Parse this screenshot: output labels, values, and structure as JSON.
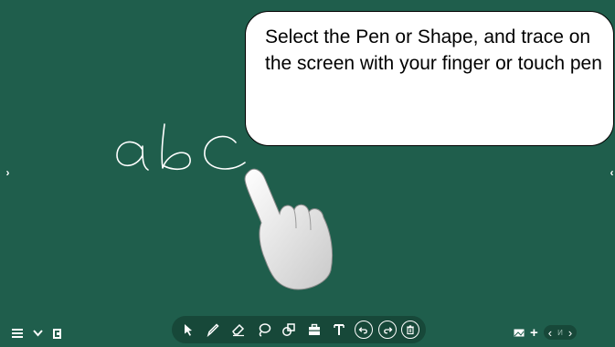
{
  "instruction": {
    "text": "Select the Pen or Shape, and trace on the screen with your finger or touch pen"
  },
  "handwriting": {
    "text": "abc"
  },
  "navigation": {
    "left_panel_arrow": "›",
    "right_panel_arrow": "‹"
  },
  "bottom_left": {
    "menu_icon": "menu-icon",
    "collapse_icon": "chevron-down-icon",
    "exit_icon": "exit-icon"
  },
  "toolbar": {
    "tools": [
      "select-tool",
      "pen-tool",
      "eraser-tool",
      "lasso-tool",
      "shape-tool",
      "toolbox-tool",
      "text-tool",
      "undo",
      "redo",
      "delete"
    ]
  },
  "bottom_right": {
    "prev_label": "‹",
    "next_label": "›",
    "page_indicator": "И",
    "add_label": "+"
  },
  "colors": {
    "board": "#1f5e4c",
    "toolbar": "#174839",
    "bubble": "#ffffff"
  }
}
